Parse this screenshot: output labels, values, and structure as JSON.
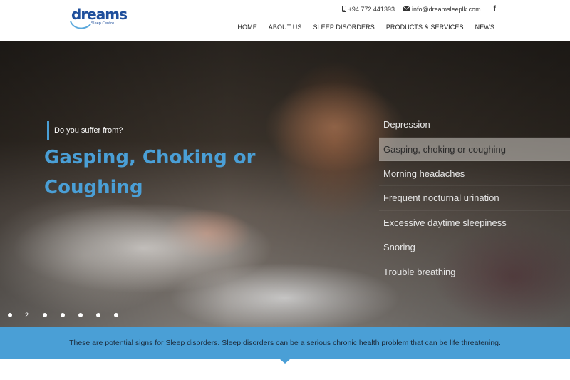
{
  "brand": {
    "logo_word": "dreams",
    "logo_sub": "Sleep Centre",
    "color": "#1f4f9c"
  },
  "contact": {
    "phone_icon": "phone-icon",
    "phone": "+94 772 441393",
    "email_icon": "envelope-icon",
    "email": "info@dreamsleeplk.com",
    "social_icon": "facebook-icon",
    "social_glyph": "f"
  },
  "nav": {
    "items": [
      "HOME",
      "ABOUT US",
      "SLEEP DISORDERS",
      "PRODUCTS & SERVICES",
      "NEWS"
    ]
  },
  "hero": {
    "question": "Do you suffer from?",
    "headline": "Gasping, Choking or Coughing",
    "accent_color": "#4a9fd6",
    "symptoms": [
      "Depression",
      "Gasping, choking or coughing",
      "Morning headaches",
      "Frequent nocturnal urination",
      "Excessive daytime sleepiness",
      "Snoring",
      "Trouble breathing"
    ],
    "active_symptom_index": 1,
    "slider": {
      "current_label": "2",
      "total_slides": 7,
      "current_index": 1
    }
  },
  "banner": {
    "message": "These are potential signs for Sleep disorders. Sleep disorders can be a serious chronic health problem that can be life threatening.",
    "color": "#4a9fd6"
  }
}
